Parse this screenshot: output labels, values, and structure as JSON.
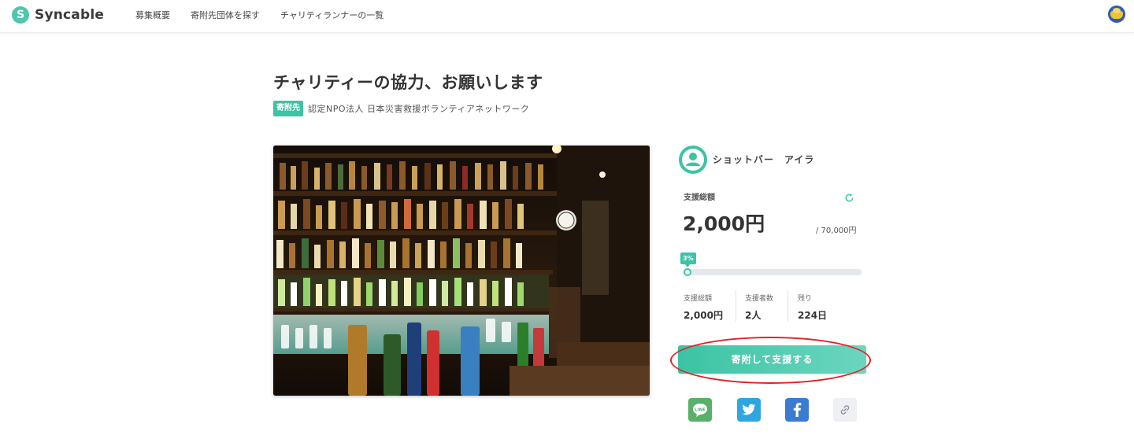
{
  "header": {
    "logo_mark": "S",
    "logo_text": "Syncable",
    "nav": [
      "募集概要",
      "寄附先団体を探す",
      "チャリティランナーの一覧"
    ]
  },
  "campaign": {
    "title": "チャリティーの協力、お願いします",
    "tag": "寄附先",
    "organization": "認定NPO法人 日本災害救援ボランティアネットワーク"
  },
  "runner": {
    "name": "ショットバー　アイラ"
  },
  "funding": {
    "total_label": "支援総額",
    "amount": "2,000円",
    "goal": "/ 70,000円",
    "progress_label": "3%",
    "progress_fraction": 0.03,
    "stats": [
      {
        "label": "支援総額",
        "value": "2,000円"
      },
      {
        "label": "支援者数",
        "value": "2人"
      },
      {
        "label": "残り",
        "value": "224日"
      }
    ]
  },
  "actions": {
    "donate_label": "寄附して支援する"
  },
  "share": {
    "line_label": "LINE"
  },
  "colors": {
    "accent": "#3cc3a4",
    "highlight": "#e02424"
  }
}
